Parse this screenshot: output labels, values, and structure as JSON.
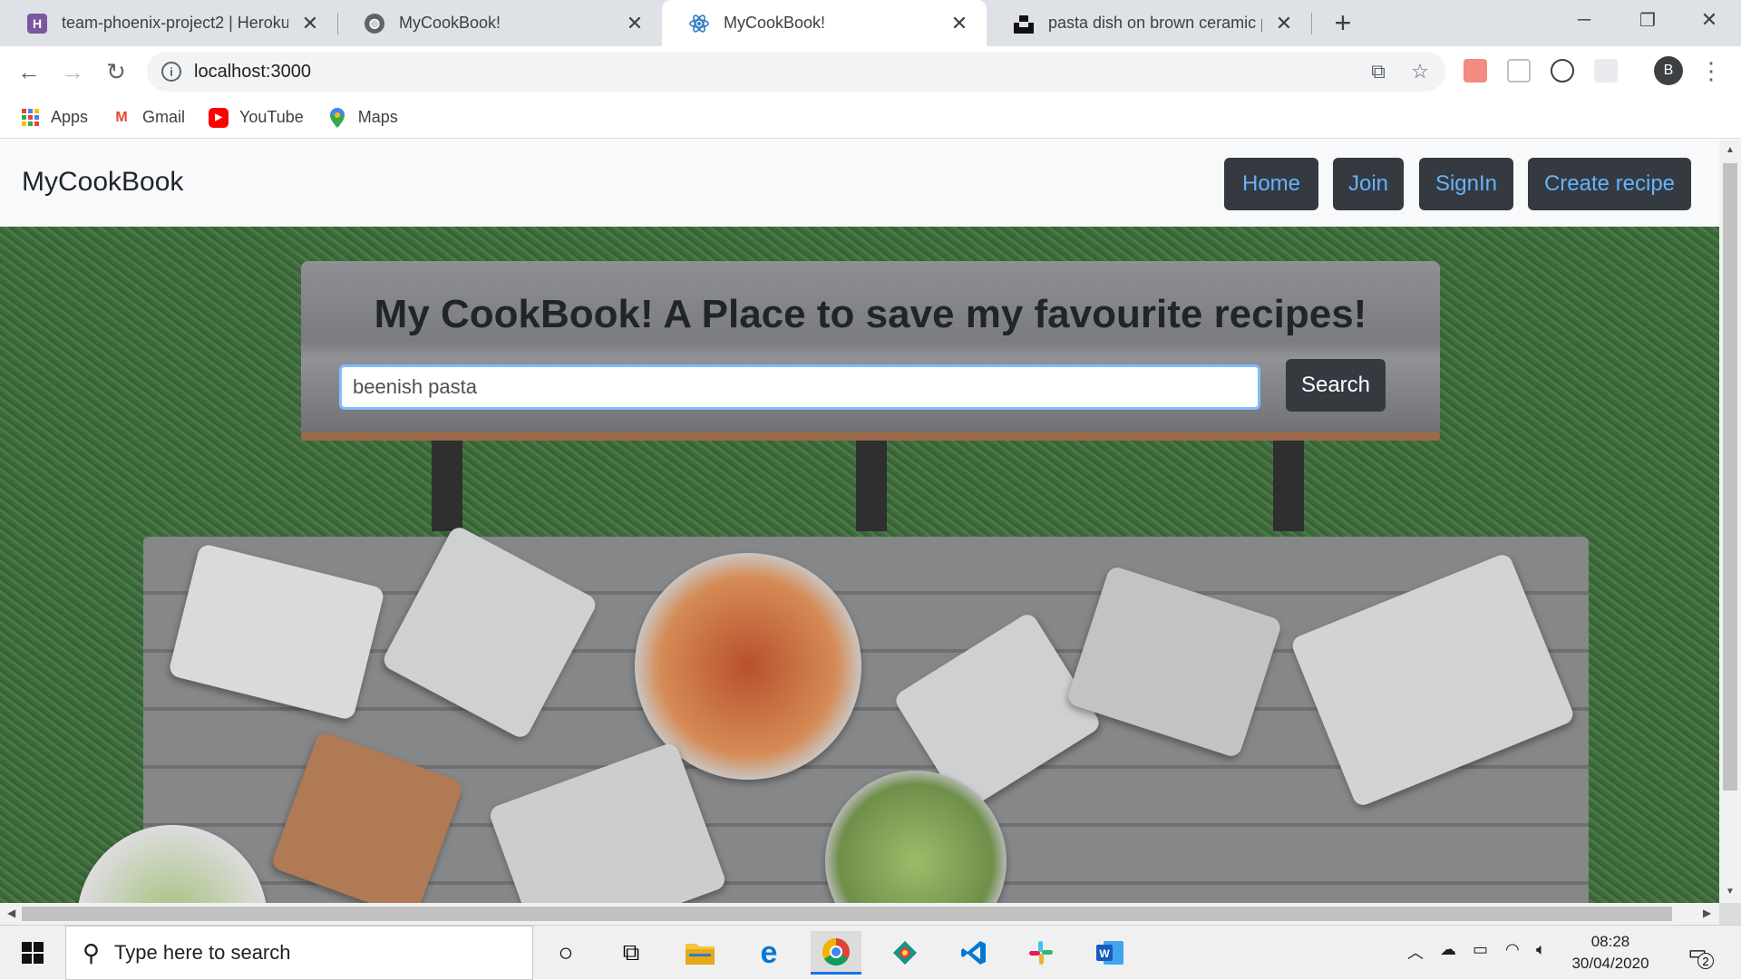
{
  "browser": {
    "tabs": [
      {
        "title": "team-phoenix-project2 | Heroku",
        "favicon": "heroku-icon",
        "favicon_letter": "H",
        "active": false
      },
      {
        "title": "MyCookBook!",
        "favicon": "globe-icon",
        "active": false
      },
      {
        "title": "MyCookBook!",
        "favicon": "react-icon",
        "active": true
      },
      {
        "title": "pasta dish on brown ceramic plat",
        "favicon": "unsplash-icon",
        "active": false
      }
    ],
    "close_glyph": "✕",
    "new_tab_glyph": "+",
    "url": "localhost:3000",
    "profile_initial": "B",
    "bookmarks": [
      {
        "label": "Apps",
        "icon": "apps-grid-icon"
      },
      {
        "label": "Gmail",
        "icon": "gmail-icon",
        "letter": "M"
      },
      {
        "label": "YouTube",
        "icon": "youtube-icon"
      },
      {
        "label": "Maps",
        "icon": "maps-pin-icon"
      }
    ]
  },
  "page": {
    "brand": "MyCookBook",
    "nav": {
      "home": "Home",
      "join": "Join",
      "signin": "SignIn",
      "create_recipe": "Create recipe"
    },
    "hero": {
      "title": "My CookBook! A Place to save my favourite recipes!",
      "search_value": "beenish pasta",
      "search_button": "Search"
    }
  },
  "taskbar": {
    "search_placeholder": "Type here to search",
    "time": "08:28",
    "date": "30/04/2020",
    "notification_count": "2",
    "pinned": [
      "cortana-icon",
      "task-view-icon",
      "file-explorer-icon",
      "edge-icon",
      "chrome-icon",
      "git-kraken-icon",
      "vscode-icon",
      "slack-icon",
      "word-icon"
    ]
  },
  "colors": {
    "nav_button_bg": "#343a40",
    "nav_button_text": "#66b2ff",
    "input_focus_border": "#80bdff"
  }
}
